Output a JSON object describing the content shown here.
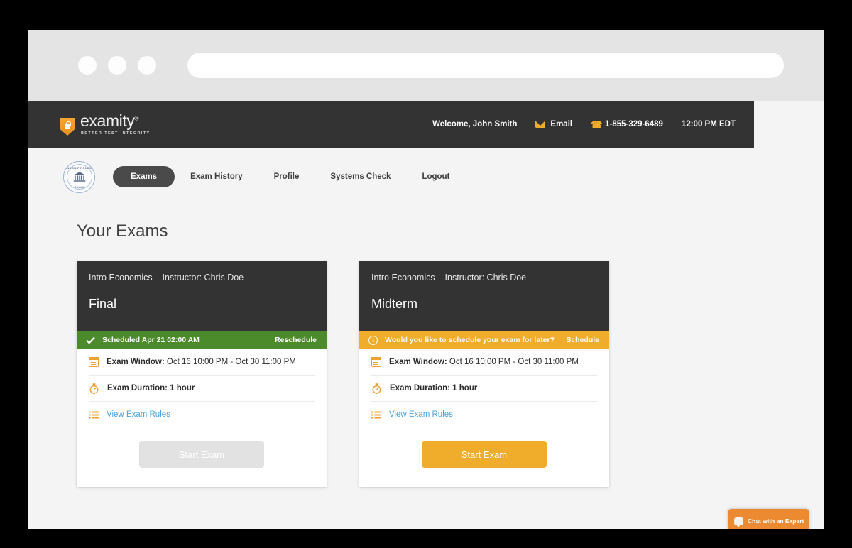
{
  "browser": {
    "url_value": "",
    "url_placeholder": "",
    "traffic_lights": [
      "close",
      "minimize",
      "maximize"
    ]
  },
  "header": {
    "logo_word": "examity",
    "logo_registered": "®",
    "logo_tagline": "BETTER TEST INTEGRITY",
    "welcome": "Welcome, John Smith",
    "email_label": "Email",
    "phone": "1-855-329-6489",
    "time": "12:00 PM EDT",
    "bg_color": "#333333",
    "accent_color": "#f0ad2b"
  },
  "nav": {
    "seal_text_top": "INSCRIPTIONEM",
    "seal_text_bottom": "TUAM",
    "items": [
      {
        "label": "Exams",
        "active": true
      },
      {
        "label": "Exam History",
        "active": false
      },
      {
        "label": "Profile",
        "active": false
      },
      {
        "label": "Systems Check",
        "active": false
      },
      {
        "label": "Logout",
        "active": false
      }
    ]
  },
  "main": {
    "page_title": "Your Exams",
    "cards": [
      {
        "course": "Intro Economics – Instructor: Chris Doe",
        "exam_name": "Final",
        "status_state": "scheduled",
        "status_text": "Scheduled Apr 21 02:00 AM",
        "status_action": "Reschedule",
        "status_color": "#4c8b2b",
        "exam_window_label": "Exam Window:",
        "exam_window_value": "Oct 16 10:00 PM - Oct 30 11:00 PM",
        "exam_duration_label": "Exam Duration: 1 hour",
        "rules_link": "View Exam Rules",
        "start_button": "Start Exam",
        "start_enabled": false
      },
      {
        "course": "Intro Economics – Instructor: Chris Doe",
        "exam_name": "Midterm",
        "status_state": "unscheduled",
        "status_text": "Would you like to schedule your exam for later?",
        "status_action": "Schedule",
        "status_color": "#f0ad2b",
        "exam_window_label": "Exam Window:",
        "exam_window_value": "Oct 16 10:00 PM - Oct 30 11:00 PM",
        "exam_duration_label": "Exam Duration: 1 hour",
        "rules_link": "View Exam Rules",
        "start_button": "Start Exam",
        "start_enabled": true
      }
    ]
  },
  "chat": {
    "label": "Chat with an Expert",
    "bg_color": "#ec8a32"
  }
}
